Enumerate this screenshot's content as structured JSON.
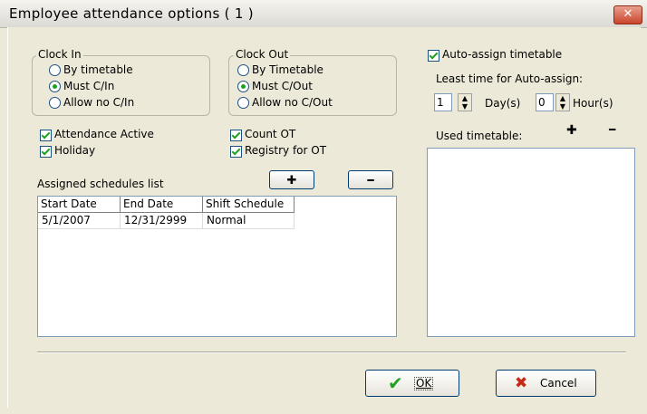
{
  "window": {
    "title": "Employee attendance options ( 1 )",
    "close_glyph": "✕"
  },
  "clock_in": {
    "legend": "Clock In",
    "options": [
      "By timetable",
      "Must C/In",
      "Allow no C/In"
    ],
    "selected": "Must C/In"
  },
  "clock_out": {
    "legend": "Clock Out",
    "options": [
      "By Timetable",
      "Must C/Out",
      "Allow no C/Out"
    ],
    "selected": "Must C/Out"
  },
  "checks": {
    "attendance_active": {
      "label": "Attendance Active",
      "checked": true
    },
    "holiday": {
      "label": "Holiday",
      "checked": true
    },
    "count_ot": {
      "label": "Count OT",
      "checked": true
    },
    "registry_ot": {
      "label": "Registry for OT",
      "checked": true
    },
    "auto_assign": {
      "label": "Auto-assign timetable",
      "checked": true
    }
  },
  "auto_assign": {
    "least_time_label": "Least time for Auto-assign:",
    "day_value": "1",
    "day_unit": "Day(s)",
    "hour_value": "0",
    "hour_unit": "Hour(s)"
  },
  "used_timetable": {
    "label": "Used timetable:",
    "add_glyph": "✚",
    "remove_glyph": "━"
  },
  "schedules": {
    "label": "Assigned schedules list",
    "add_glyph": "✚",
    "remove_glyph": "━",
    "columns": [
      "Start Date",
      "End Date",
      "Shift Schedule"
    ],
    "rows": [
      [
        "5/1/2007",
        "12/31/2999",
        "Normal"
      ]
    ]
  },
  "buttons": {
    "ok": "OK",
    "cancel": "Cancel"
  },
  "colors": {
    "check_green": "#21a121",
    "cancel_red": "#c42a16",
    "title_close": "#c9452b"
  }
}
